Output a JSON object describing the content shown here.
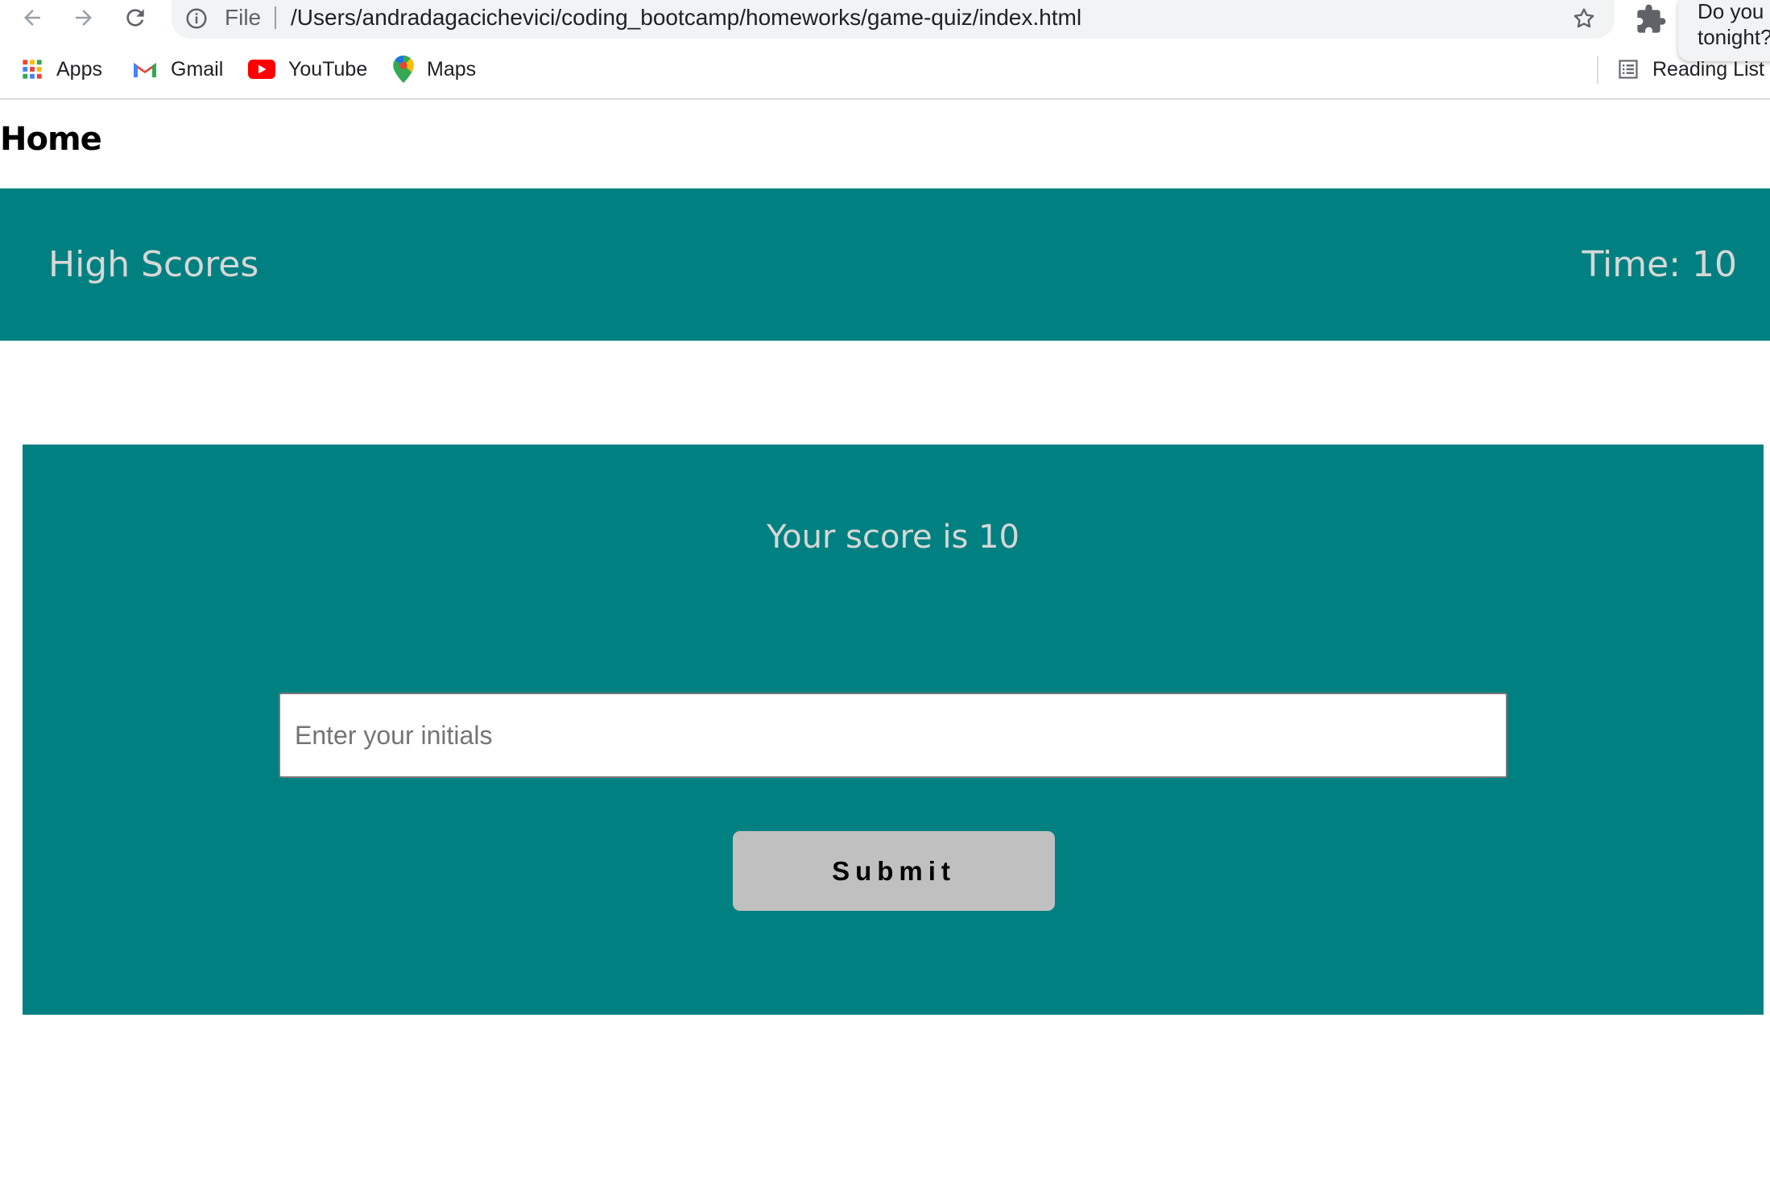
{
  "browser": {
    "address": {
      "scheme_label": "File",
      "url": "/Users/andradagacichevici/coding_bootcamp/homeworks/game-quiz/index.html"
    },
    "notification_text": "Do you\ntonight?",
    "bookmarks": [
      {
        "label": "Apps",
        "icon": "apps-grid-icon"
      },
      {
        "label": "Gmail",
        "icon": "gmail-icon"
      },
      {
        "label": "YouTube",
        "icon": "youtube-icon"
      },
      {
        "label": "Maps",
        "icon": "maps-pin-icon"
      }
    ],
    "reading_list_label": "Reading List"
  },
  "page": {
    "home_link": "Home",
    "header": {
      "high_scores_link": "High Scores",
      "timer_text": "Time: 10"
    },
    "quiz": {
      "score_text": "Your score is 10",
      "initials_placeholder": "Enter your initials",
      "initials_value": "",
      "submit_label": "Submit"
    }
  },
  "colors": {
    "teal": "#008080",
    "header_text": "#d7d7d7",
    "submit_bg": "#c0c0c0"
  }
}
